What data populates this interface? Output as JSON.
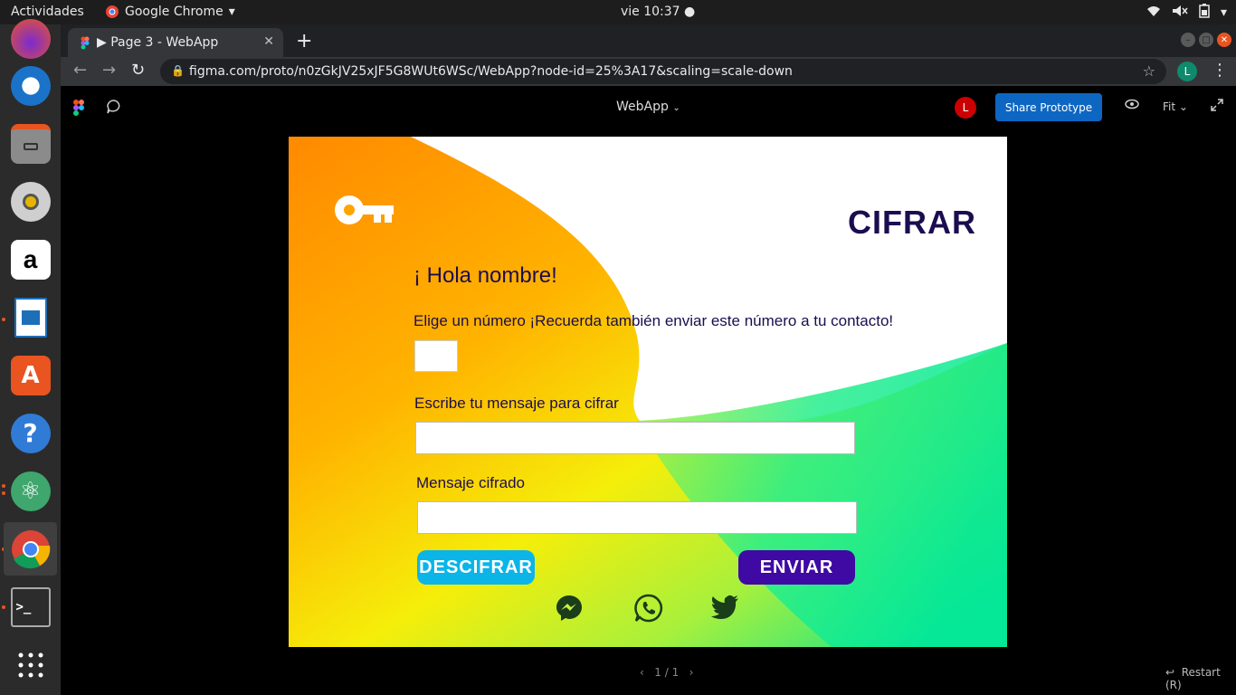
{
  "topbar": {
    "activities": "Actividades",
    "app_name": "Google Chrome",
    "clock": "vie 10:37"
  },
  "dock": {
    "items": [
      "firefox-icon",
      "thunderbird-icon",
      "files-icon",
      "rhythmbox-icon",
      "amazon-icon",
      "writer-icon",
      "software-icon",
      "help-icon",
      "atom-icon",
      "chrome-icon",
      "terminal-icon",
      "apps-grid-icon"
    ]
  },
  "chrome": {
    "tab_title": "▶ Page 3 - WebApp",
    "url": "figma.com/proto/n0zGkJV25xJF5G8WUt6WSc/WebApp?node-id=25%3A17&scaling=scale-down",
    "profile_initial": "L"
  },
  "figma": {
    "file_title": "WebApp",
    "avatar_initial": "L",
    "share_label": "Share Prototype",
    "zoom_label": "Fit",
    "pager": "1 / 1",
    "restart_label": "Restart (R)"
  },
  "app": {
    "title": "CIFRAR",
    "greeting": "¡ Hola nombre!",
    "number_label": "Elige un número ¡Recuerda también enviar este número a tu contacto!",
    "message_label": "Escribe tu mensaje para cifrar",
    "ciphered_label": "Mensaje cifrado",
    "decipher_button": "DESCIFRAR",
    "send_button": "ENVIAR",
    "colors": {
      "title": "#1b0d4f",
      "decipher": "#0bb5e8",
      "send": "#3e0aa3"
    }
  }
}
